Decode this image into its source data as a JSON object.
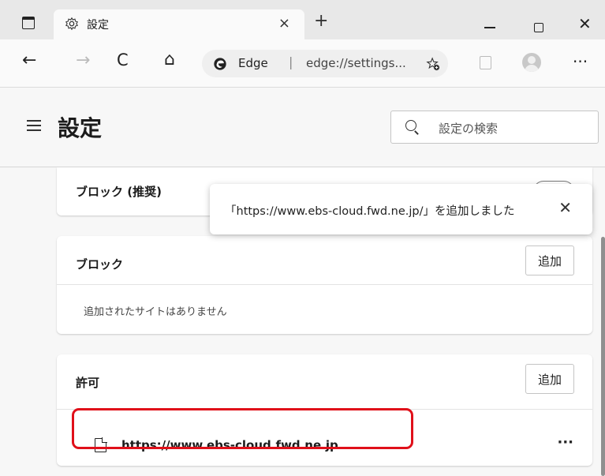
{
  "window": {
    "tab_title": "設定",
    "tab_close": "×",
    "new_tab": "+",
    "minimize_label": "—",
    "close_label": "✕"
  },
  "toolbar": {
    "back": "←",
    "forward": "→",
    "refresh": "C",
    "home": "⌂",
    "address_label": "Edge",
    "address_separator": "|",
    "address_url": "edge://settings...",
    "favorites_icon": "star-add-icon",
    "more": "···"
  },
  "settings": {
    "title": "設定",
    "search_placeholder": "設定の検索"
  },
  "block_recommended": {
    "title": "ブロック (推奨)"
  },
  "toast": {
    "message": "「https://www.ebs-cloud.fwd.ne.jp/」を追加しました",
    "close": "✕"
  },
  "block_section": {
    "title": "ブロック",
    "add_label": "追加",
    "empty_text": "追加されたサイトはありません"
  },
  "allow_section": {
    "title": "許可",
    "add_label": "追加",
    "sites": [
      {
        "url": "https://www.ebs-cloud.fwd.ne.jp",
        "more": "···"
      }
    ]
  },
  "colors": {
    "highlight": "#e0101a",
    "background": "#f7f7f7",
    "card": "#ffffff"
  }
}
